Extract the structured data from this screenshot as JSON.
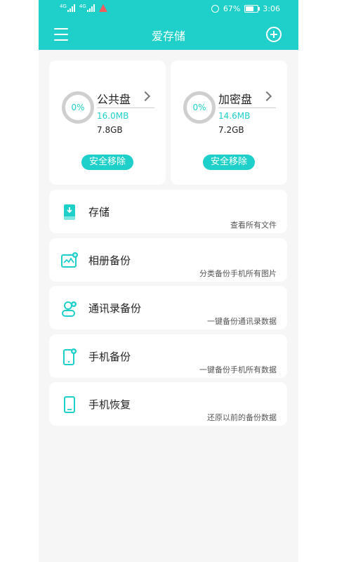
{
  "status_bar": {
    "network_left": "4G",
    "network_right": "4G",
    "battery_percent": "67%",
    "battery_level": 0.67,
    "time": "3:06"
  },
  "header": {
    "title": "爱存储"
  },
  "disks": [
    {
      "name": "公共盘",
      "percent": "0%",
      "used": "16.0MB",
      "total": "7.8GB",
      "eject_label": "安全移除"
    },
    {
      "name": "加密盘",
      "percent": "0%",
      "used": "14.6MB",
      "total": "7.2GB",
      "eject_label": "安全移除"
    }
  ],
  "features": [
    {
      "title": "存储",
      "subtitle": "查看所有文件",
      "icon": "storage-icon"
    },
    {
      "title": "相册备份",
      "subtitle": "分类备份手机所有图片",
      "icon": "photo-backup-icon"
    },
    {
      "title": "通讯录备份",
      "subtitle": "一键备份通讯录数据",
      "icon": "contacts-backup-icon"
    },
    {
      "title": "手机备份",
      "subtitle": "一键备份手机所有数据",
      "icon": "phone-backup-icon"
    },
    {
      "title": "手机恢复",
      "subtitle": "还原以前的备份数据",
      "icon": "phone-restore-icon"
    }
  ],
  "colors": {
    "accent": "#1fcfc9",
    "background": "#f6f6f6",
    "ring": "#cfcfcf",
    "warning": "#f05b5b"
  }
}
